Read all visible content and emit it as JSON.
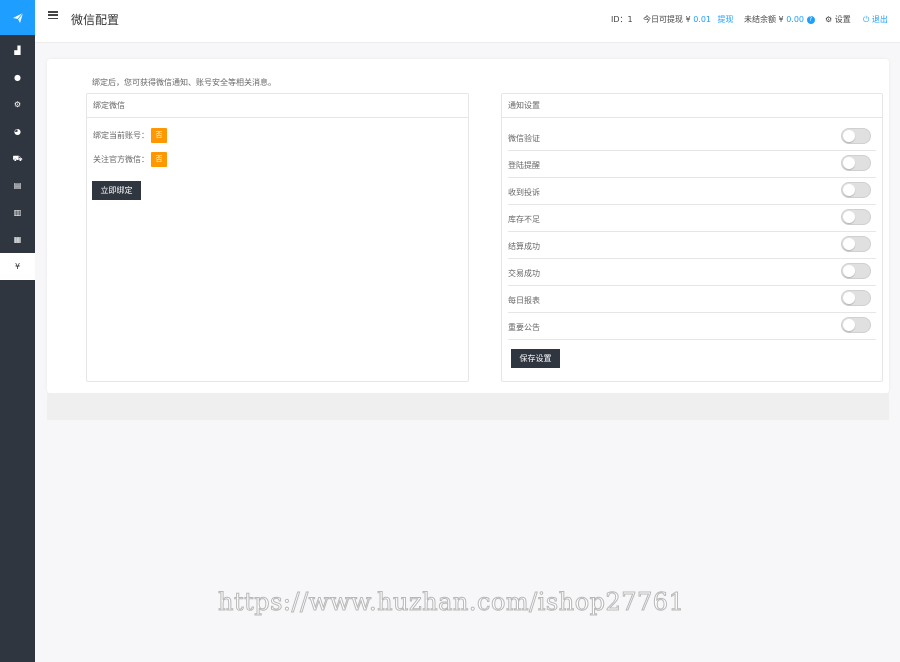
{
  "sidebar": {
    "logo_icon": "paper-plane-icon",
    "items": [
      {
        "icon": "area-chart-icon",
        "glyph": "▟"
      },
      {
        "icon": "user-icon",
        "glyph": "●"
      },
      {
        "icon": "settings-circle-icon",
        "glyph": "⚙"
      },
      {
        "icon": "globe-icon",
        "glyph": "◕"
      },
      {
        "icon": "shopping-cart-icon",
        "glyph": "⛟"
      },
      {
        "icon": "id-card-icon",
        "glyph": "▤"
      },
      {
        "icon": "barcode-icon",
        "glyph": "▥"
      },
      {
        "icon": "ad-icon",
        "glyph": "▦"
      },
      {
        "icon": "yen-icon",
        "glyph": "¥",
        "active": true
      }
    ]
  },
  "header": {
    "title": "微信配置",
    "id_label": "ID：1",
    "withdraw_label": "今日可提现 ¥ ",
    "withdraw_amount": "0.01",
    "withdraw_link": "提现",
    "unsettled_label": "未结余额 ¥ ",
    "unsettled_amount": "0.00",
    "help_mark": "?",
    "settings_label": "设置",
    "logout_label": "退出"
  },
  "notice": "绑定后，您可获得微信通知、账号安全等相关消息。",
  "bind_panel": {
    "title": "绑定微信",
    "rows": [
      {
        "label": "绑定当前账号：",
        "value": "否"
      },
      {
        "label": "关注官方微信：",
        "value": "否"
      }
    ],
    "button": "立即绑定"
  },
  "notify_panel": {
    "title": "通知设置",
    "items": [
      {
        "label": "微信验证",
        "enabled": false
      },
      {
        "label": "登陆提醒",
        "enabled": false
      },
      {
        "label": "收到投诉",
        "enabled": false
      },
      {
        "label": "库存不足",
        "enabled": false
      },
      {
        "label": "结算成功",
        "enabled": false
      },
      {
        "label": "交易成功",
        "enabled": false
      },
      {
        "label": "每日报表",
        "enabled": false
      },
      {
        "label": "重要公告",
        "enabled": false
      }
    ],
    "button": "保存设置"
  },
  "watermark": "https://www.huzhan.com/ishop27761",
  "colors": {
    "accent": "#1e9fff",
    "sidebar": "#2f3640",
    "badge": "#ff9800"
  }
}
